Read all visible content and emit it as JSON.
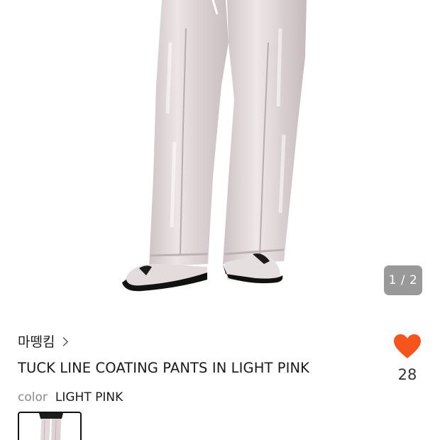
{
  "gallery": {
    "page_indicator": "1 / 2"
  },
  "product": {
    "brand": "마뗑킴",
    "title": "TUCK LINE COATING PANTS IN LIGHT PINK",
    "like_count": "28",
    "color_label": "color",
    "color_value": "LIGHT PINK"
  },
  "colors": {
    "heart": "#f5541c",
    "pants": "#e3dadb",
    "indicator_bg": "#5a5a5a"
  },
  "icons": {
    "brand_chevron": "chevron-right-icon",
    "like": "heart-icon"
  }
}
